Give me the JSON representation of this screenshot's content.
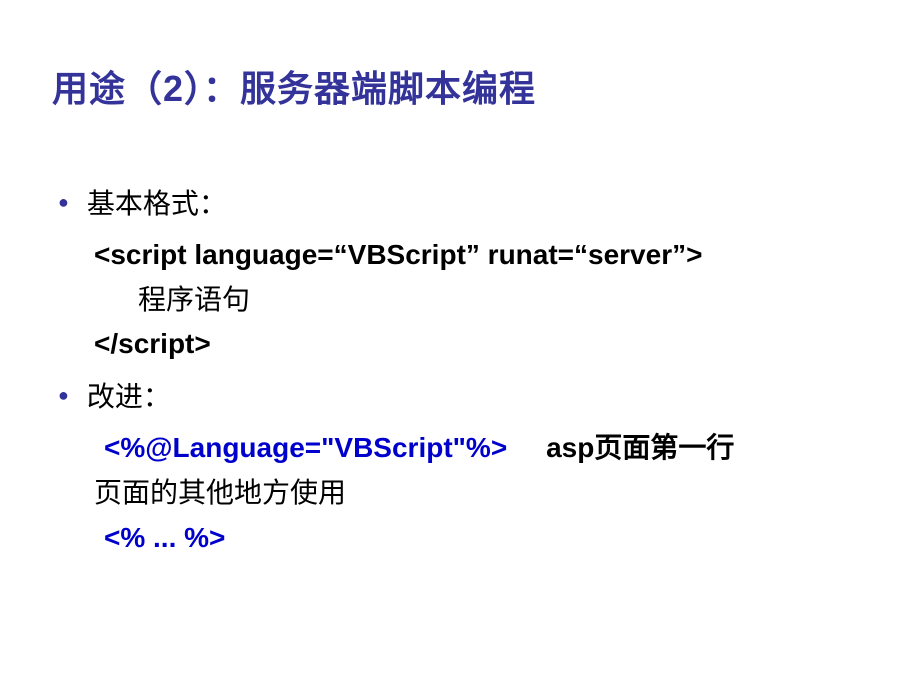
{
  "slide": {
    "title": "用途（2）：服务器端脚本编程",
    "bullet1": {
      "label": "基本格式：",
      "code_open": "<script language=“VBScript” runat=“server”>",
      "code_body": "程序语句",
      "code_close": "</script>"
    },
    "bullet2": {
      "label": "改进：",
      "code_directive": "<%@Language=\"VBScript\"%>",
      "code_note": "asp页面第一行",
      "usage_text": "页面的其他地方使用",
      "code_block": "<% ... %>"
    }
  }
}
